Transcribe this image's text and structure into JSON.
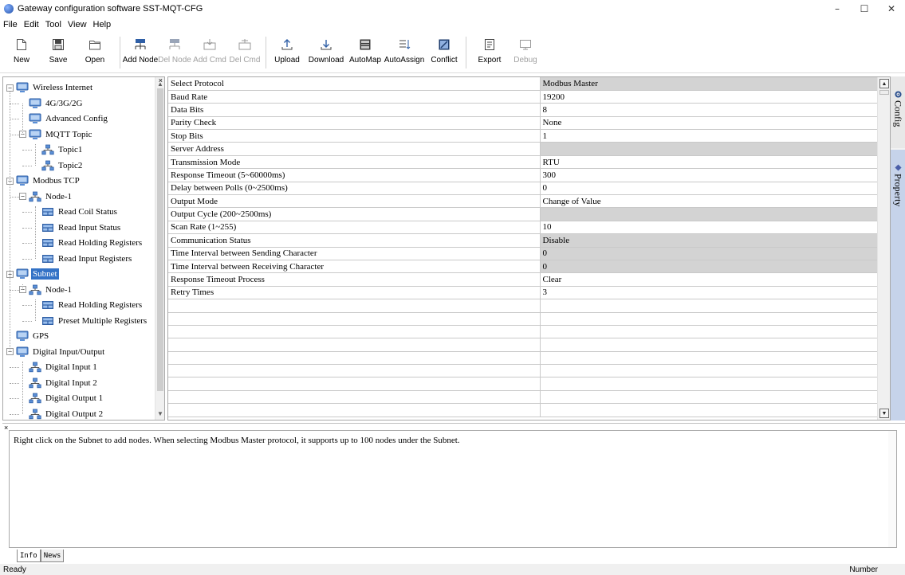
{
  "window": {
    "title": "Gateway configuration software SST-MQT-CFG",
    "minimize": "–",
    "maximize": "☐",
    "close": "✕"
  },
  "menu": [
    "File",
    "Edit",
    "Tool",
    "View",
    "Help"
  ],
  "toolbar": [
    {
      "label": "New",
      "icon": "new-file-icon",
      "enabled": true
    },
    {
      "label": "Save",
      "icon": "save-icon",
      "enabled": true
    },
    {
      "label": "Open",
      "icon": "open-folder-icon",
      "enabled": true
    },
    {
      "label": "Add Node",
      "icon": "add-node-icon",
      "enabled": true
    },
    {
      "label": "Del Node",
      "icon": "delete-node-icon",
      "enabled": false
    },
    {
      "label": "Add Cmd",
      "icon": "add-command-icon",
      "enabled": false
    },
    {
      "label": "Del Cmd",
      "icon": "delete-command-icon",
      "enabled": false
    },
    {
      "label": "Upload",
      "icon": "upload-icon",
      "enabled": true
    },
    {
      "label": "Download",
      "icon": "download-icon",
      "enabled": true
    },
    {
      "label": "AutoMap",
      "icon": "automap-icon",
      "enabled": true
    },
    {
      "label": "AutoAssign",
      "icon": "autoassign-icon",
      "enabled": true
    },
    {
      "label": "Conflict",
      "icon": "conflict-icon",
      "enabled": true
    },
    {
      "label": "Export",
      "icon": "export-icon",
      "enabled": true
    },
    {
      "label": "Debug",
      "icon": "debug-icon",
      "enabled": false
    }
  ],
  "tree": [
    {
      "label": "Wireless Internet",
      "icon": "monitor-icon",
      "level": 0,
      "expander": "−"
    },
    {
      "label": "4G/3G/2G",
      "icon": "monitor-icon",
      "level": 1
    },
    {
      "label": "Advanced Config",
      "icon": "monitor-icon",
      "level": 1
    },
    {
      "label": "MQTT Topic",
      "icon": "monitor-icon",
      "level": 1,
      "expander": "−"
    },
    {
      "label": "Topic1",
      "icon": "network-node-icon",
      "level": 2
    },
    {
      "label": "Topic2",
      "icon": "network-node-icon",
      "level": 2
    },
    {
      "label": "Modbus TCP",
      "icon": "monitor-icon",
      "level": 0,
      "expander": "−"
    },
    {
      "label": "Node-1",
      "icon": "network-node-icon",
      "level": 1,
      "expander": "−"
    },
    {
      "label": "Read Coil Status",
      "icon": "register-icon",
      "level": 2
    },
    {
      "label": "Read Input Status",
      "icon": "register-icon",
      "level": 2
    },
    {
      "label": "Read Holding Registers",
      "icon": "register-icon",
      "level": 2
    },
    {
      "label": "Read Input Registers",
      "icon": "register-icon",
      "level": 2
    },
    {
      "label": "Subnet",
      "icon": "monitor-icon",
      "level": 0,
      "expander": "−",
      "selected": true
    },
    {
      "label": "Node-1",
      "icon": "network-node-icon",
      "level": 1,
      "expander": "−"
    },
    {
      "label": "Read Holding Registers",
      "icon": "register-icon",
      "level": 2
    },
    {
      "label": "Preset Multiple Registers",
      "icon": "register-icon",
      "level": 2
    },
    {
      "label": "GPS",
      "icon": "monitor-icon",
      "level": 0
    },
    {
      "label": "Digital Input/Output",
      "icon": "monitor-icon",
      "level": 0,
      "expander": "−"
    },
    {
      "label": "Digital Input 1",
      "icon": "network-node-icon",
      "level": 1
    },
    {
      "label": "Digital Input 2",
      "icon": "network-node-icon",
      "level": 1
    },
    {
      "label": "Digital Output 1",
      "icon": "network-node-icon",
      "level": 1
    },
    {
      "label": "Digital Output 2",
      "icon": "network-node-icon",
      "level": 1
    }
  ],
  "properties": [
    {
      "key": "Select Protocol",
      "value": "Modbus Master",
      "gray": true
    },
    {
      "key": "Baud Rate",
      "value": "19200",
      "gray": false
    },
    {
      "key": "Data Bits",
      "value": "8",
      "gray": false
    },
    {
      "key": "Parity Check",
      "value": "None",
      "gray": false
    },
    {
      "key": "Stop Bits",
      "value": "1",
      "gray": false
    },
    {
      "key": "Server Address",
      "value": "",
      "gray": true
    },
    {
      "key": "Transmission Mode",
      "value": "RTU",
      "gray": false
    },
    {
      "key": "Response Timeout (5~60000ms)",
      "value": "300",
      "gray": false
    },
    {
      "key": "Delay between Polls (0~2500ms)",
      "value": "0",
      "gray": false
    },
    {
      "key": "Output Mode",
      "value": "Change of Value",
      "gray": false
    },
    {
      "key": "Output Cycle (200~2500ms)",
      "value": "",
      "gray": true
    },
    {
      "key": "Scan Rate (1~255)",
      "value": "10",
      "gray": false
    },
    {
      "key": "Communication Status",
      "value": "Disable",
      "gray": true
    },
    {
      "key": "Time Interval between Sending Character",
      "value": "0",
      "gray": true
    },
    {
      "key": "Time Interval between Receiving Character",
      "value": "0",
      "gray": true
    },
    {
      "key": "Response Timeout Process",
      "value": "Clear",
      "gray": false
    },
    {
      "key": "Retry Times",
      "value": "3",
      "gray": false
    }
  ],
  "empty_rows": 9,
  "side_tabs": [
    {
      "label": "Config",
      "icon": "gear-icon",
      "active": true
    },
    {
      "label": "Property",
      "icon": "diamond-icon",
      "active": false
    }
  ],
  "info": {
    "message": "Right click on the Subnet to add nodes. When selecting Modbus Master protocol, it supports up to 100 nodes under the Subnet.",
    "tabs": [
      "Info",
      "News"
    ]
  },
  "status": {
    "left": "Ready",
    "right": "Number"
  },
  "close_glyph": "×"
}
